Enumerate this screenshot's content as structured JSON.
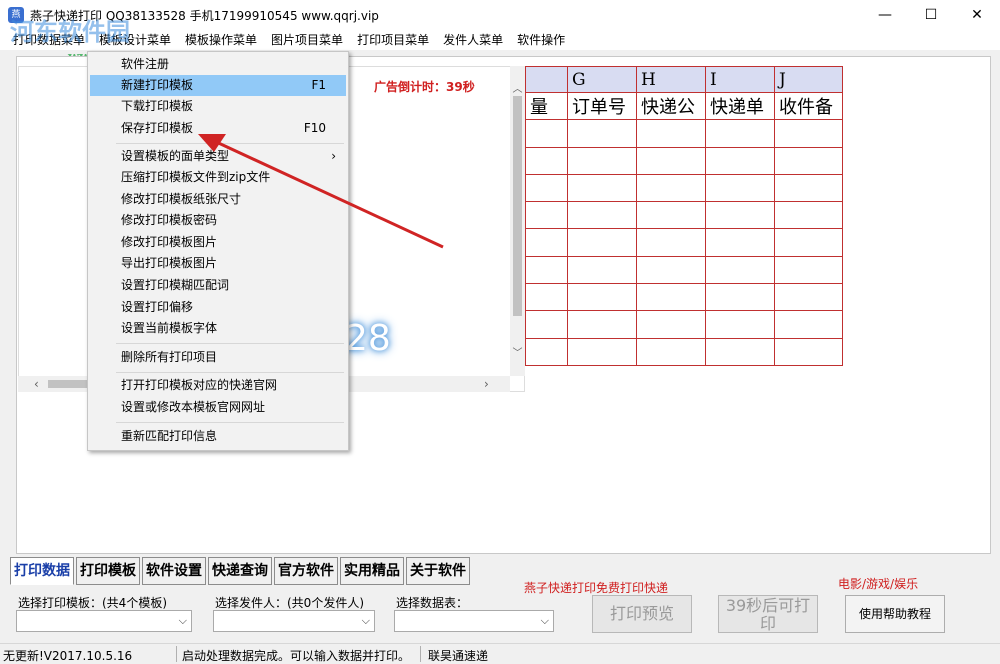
{
  "window": {
    "title": "燕子快递打印  QQ38133528  手机17199910545  www.qqrj.vip",
    "minimize": "—",
    "maximize": "☐",
    "close": "✕"
  },
  "watermark": {
    "text": "河东软件园",
    "url": "www.pc0359.cn"
  },
  "menubar": [
    "打印数据菜单",
    "模板设计菜单",
    "模板操作菜单",
    "图片项目菜单",
    "打印项目菜单",
    "发件人菜单",
    "软件操作"
  ],
  "context_menu": {
    "items": [
      {
        "label": "软件注册",
        "shortcut": ""
      },
      {
        "label": "新建打印模板",
        "shortcut": "F1"
      },
      {
        "label": "下载打印模板",
        "shortcut": ""
      },
      {
        "label": "保存打印模板",
        "shortcut": "F10"
      },
      {
        "label": "设置模板的面单类型",
        "shortcut": ""
      },
      {
        "label": "压缩打印模板文件到zip文件",
        "shortcut": ""
      },
      {
        "label": "修改打印模板纸张尺寸",
        "shortcut": ""
      },
      {
        "label": "修改打印模板密码",
        "shortcut": ""
      },
      {
        "label": "修改打印模板图片",
        "shortcut": ""
      },
      {
        "label": "导出打印模板图片",
        "shortcut": ""
      },
      {
        "label": "设置打印模糊匹配词",
        "shortcut": ""
      },
      {
        "label": "设置打印偏移",
        "shortcut": ""
      },
      {
        "label": "设置当前模板字体",
        "shortcut": ""
      },
      {
        "label": "删除所有打印项目",
        "shortcut": ""
      },
      {
        "label": "打开打印模板对应的快递官网",
        "shortcut": ""
      },
      {
        "label": "设置或修改本模板官网网址",
        "shortcut": ""
      },
      {
        "label": "重新匹配打印信息",
        "shortcut": ""
      }
    ],
    "submenu_arrow": "›",
    "highlighted_index": 1
  },
  "preview": {
    "ad_countdown": "广告倒计时：39秒",
    "glow_text": "28"
  },
  "grid": {
    "columns": [
      "G",
      "H",
      "I",
      "J"
    ],
    "subheaders": [
      "量",
      "订单号",
      "快递公",
      "快递单",
      "收件备"
    ]
  },
  "tabs": [
    "打印数据",
    "打印模板",
    "软件设置",
    "快递查询",
    "官方软件",
    "实用精品",
    "关于软件"
  ],
  "promo": {
    "left": "燕子快递打印免费打印快递",
    "right": "电影/游戏/娱乐"
  },
  "bottom": {
    "template_label": "选择打印模板：(共4个模板)",
    "sender_label": "选择发件人：(共0个发件人)",
    "datatable_label": "选择数据表：",
    "preview_button": "打印预览",
    "print_button": "39秒后可打印",
    "help_button": "使用帮助教程",
    "dropdown_arrow": "⌵"
  },
  "status": {
    "left": "无更新!V2017.10.5.16",
    "middle": "启动处理数据完成。可以输入数据并打印。",
    "right": "联昊通速递"
  },
  "colors": {
    "accent_red": "#d02020",
    "grid_border": "#c03030",
    "menu_highlight": "#91c9f7",
    "tab_active": "#1a3fa8"
  }
}
